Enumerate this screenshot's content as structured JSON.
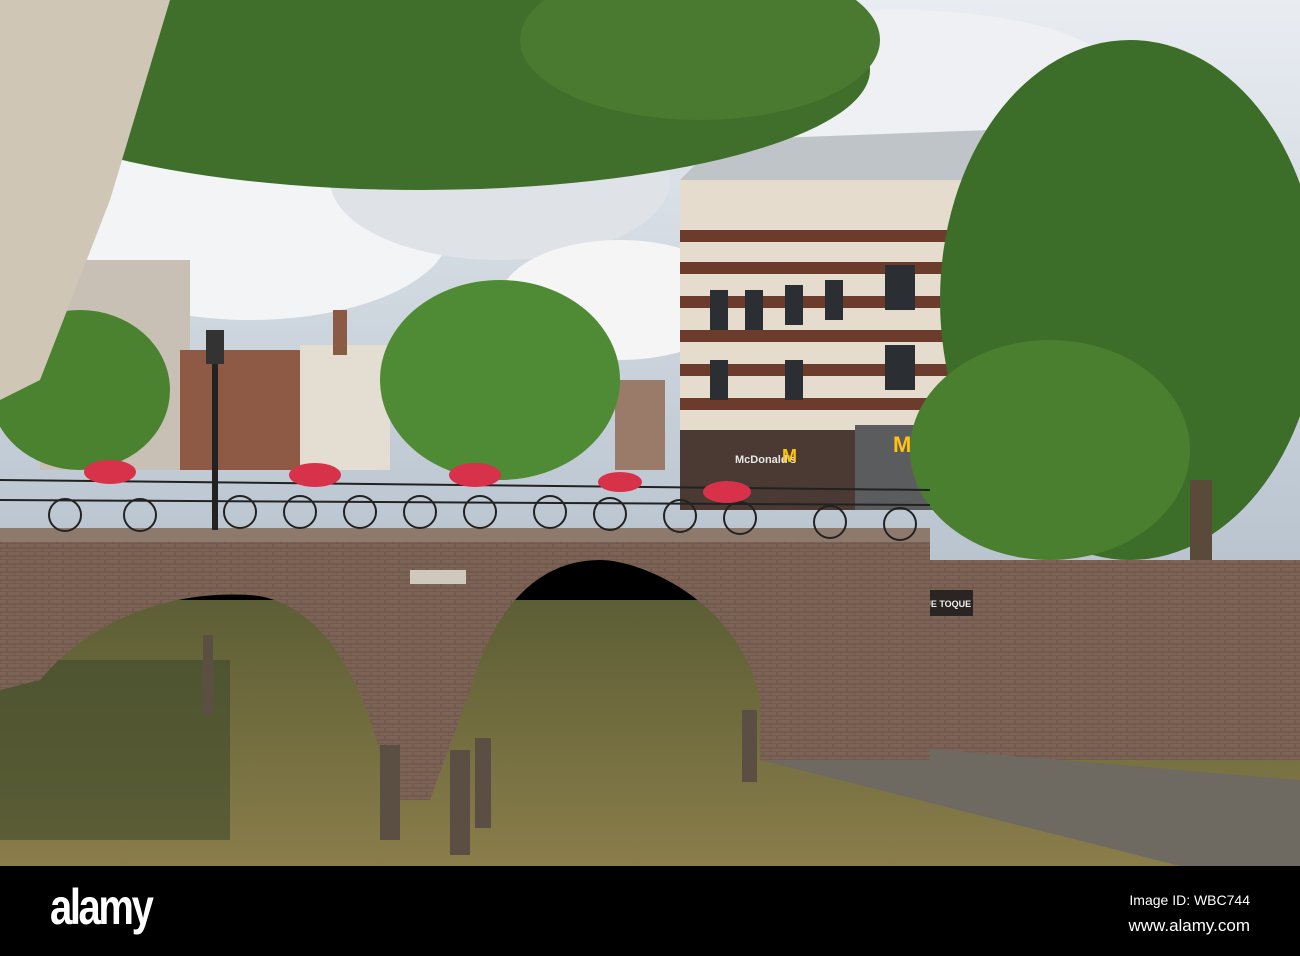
{
  "photo": {
    "signs": {
      "restaurant": "McDonald's",
      "restaurant_logo": "M",
      "cafe": "TOQUE TOQUE"
    },
    "colors": {
      "sky": "#c9d3de",
      "water": "#6f6a3a",
      "brick": "#7c6356",
      "foliage": "#3f6f2a",
      "mcdonalds_yellow": "#ffc20e"
    }
  },
  "watermark": {
    "logo": "alamy",
    "image_id": "Image ID: WBC744",
    "url": "www.alamy.com"
  }
}
